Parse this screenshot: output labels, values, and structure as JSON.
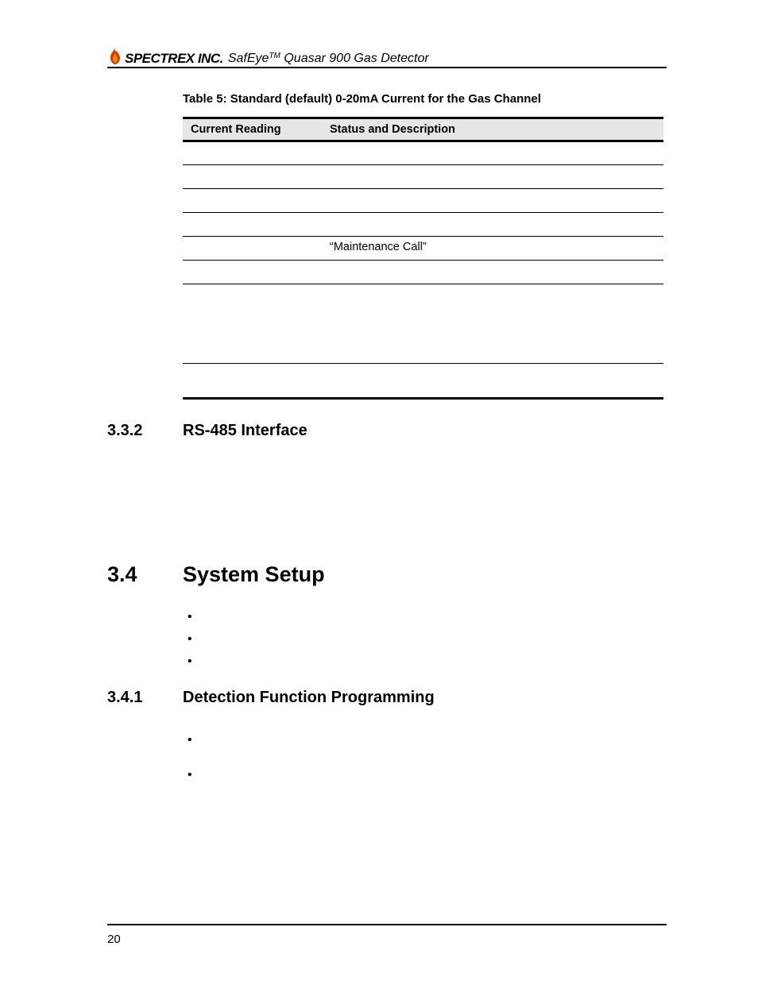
{
  "header": {
    "brand": "SPECTREX INC.",
    "title_prefix": "SafEye",
    "title_tm": "TM",
    "title_rest": " Quasar 900 Gas Detector"
  },
  "table": {
    "caption": "Table 5: Standard (default) 0-20mA Current for the Gas Channel",
    "col_reading": "Current Reading",
    "col_status": "Status and Description",
    "rows": [
      {
        "reading": "",
        "status": ""
      },
      {
        "reading": "",
        "status": ""
      },
      {
        "reading": "",
        "status": ""
      },
      {
        "reading": "",
        "status": ""
      },
      {
        "reading": "",
        "status": "“Maintenance Call”"
      },
      {
        "reading": "",
        "status": ""
      },
      {
        "reading": "",
        "status": ""
      },
      {
        "reading": "",
        "status": ""
      }
    ]
  },
  "sec332": {
    "num": "3.3.2",
    "title": "RS-485 Interface"
  },
  "sec34": {
    "num": "3.4",
    "title": "System Setup"
  },
  "sec341": {
    "num": "3.4.1",
    "title": "Detection Function Programming"
  },
  "bullets34": [
    "",
    "",
    ""
  ],
  "bullets341": [
    "",
    ""
  ],
  "page_number": "20"
}
